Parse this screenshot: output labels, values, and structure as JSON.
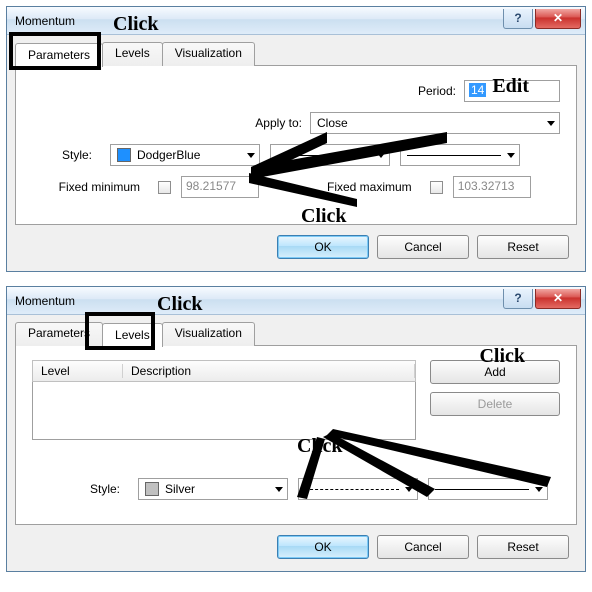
{
  "dialog1": {
    "title": "Momentum",
    "tabs": [
      "Parameters",
      "Levels",
      "Visualization"
    ],
    "activeTab": 0,
    "periodLabel": "Period:",
    "periodValue": "14",
    "applyLabel": "Apply to:",
    "applyValue": "Close",
    "styleLabel": "Style:",
    "styleColorName": "DodgerBlue",
    "styleColorHex": "#1e90ff",
    "fixedMinLabel": "Fixed minimum",
    "fixedMinValue": "98.21577",
    "fixedMaxLabel": "Fixed maximum",
    "fixedMaxValue": "103.32713",
    "ok": "OK",
    "cancel": "Cancel",
    "reset": "Reset",
    "annot_click_tab": "Click",
    "annot_edit": "Edit",
    "annot_click_style": "Click"
  },
  "dialog2": {
    "title": "Momentum",
    "tabs": [
      "Parameters",
      "Levels",
      "Visualization"
    ],
    "activeTab": 1,
    "levelHeader": "Level",
    "descHeader": "Description",
    "addLabel": "Add",
    "deleteLabel": "Delete",
    "styleLabel": "Style:",
    "styleColorName": "Silver",
    "styleColorHex": "#c0c0c0",
    "ok": "OK",
    "cancel": "Cancel",
    "reset": "Reset",
    "annot_click_tab": "Click",
    "annot_click_add": "Click",
    "annot_click_style": "Click"
  }
}
